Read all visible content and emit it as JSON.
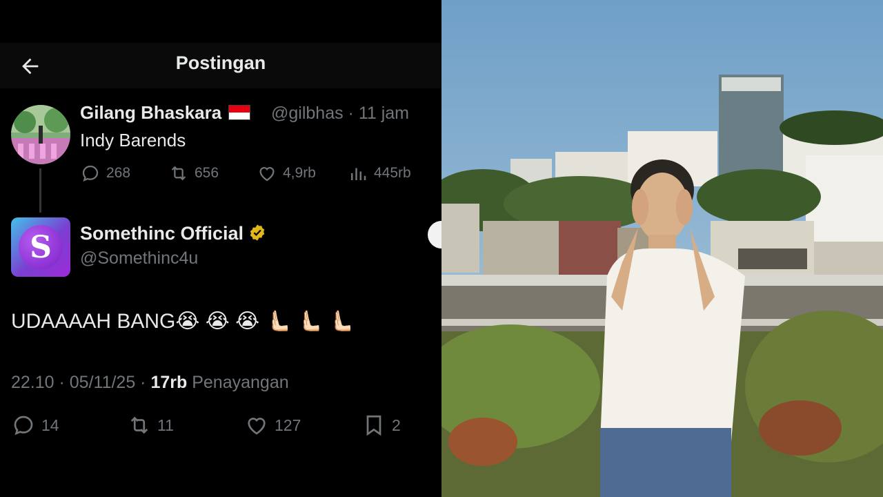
{
  "header": {
    "title": "Postingan"
  },
  "parent_post": {
    "author_name": "Gilang Bhaskara",
    "handle_time": "@gilbhas · 11 jam",
    "text": "Indy Barends",
    "replies": "268",
    "reposts": "656",
    "likes": "4,9rb",
    "views": "445rb"
  },
  "main_post": {
    "author_name": "Somethinc Official",
    "handle": "@Somethinc4u",
    "avatar_letter": "S",
    "text": "UDAAAAH BANG😭 😭 😭  🫷🏻 🫷🏻 🫷🏻",
    "timestamp": "22.10 · 05/11/25 · ",
    "views_count": "17rb",
    "views_label": " Penayangan",
    "replies": "14",
    "reposts": "11",
    "likes": "127",
    "bookmarks": "2"
  },
  "colors": {
    "background": "#000000",
    "text": "#e7e9ea",
    "muted": "#71767b",
    "verified_gold": "#e2b719"
  },
  "icons": [
    "back-arrow-icon",
    "reply-icon",
    "repost-icon",
    "like-icon",
    "views-icon",
    "bookmark-icon",
    "verified-badge-icon",
    "indonesia-flag-icon"
  ]
}
